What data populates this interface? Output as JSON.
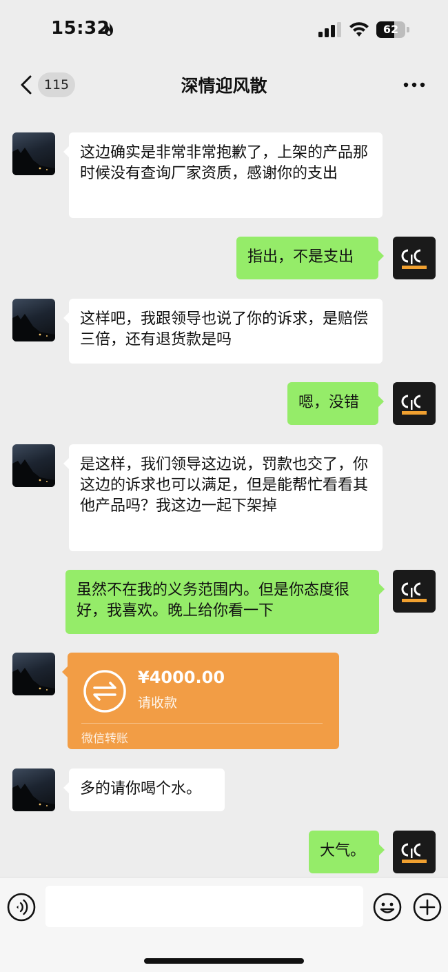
{
  "status_bar": {
    "time": "15:32",
    "battery": "62",
    "battery_level": 0.62,
    "icons": [
      "flame-icon",
      "signal-icon",
      "wifi-icon",
      "battery-icon"
    ]
  },
  "nav": {
    "unread_count": "115",
    "title": "深情迎风散",
    "icons": [
      "chevron-left-icon",
      "more-icon"
    ]
  },
  "messages": [
    {
      "side": "left",
      "text": "这边确实是非常非常抱歉了，上架的产品那时候没有查询厂家资质，感谢你的支出"
    },
    {
      "side": "right",
      "text": "指出，不是支出"
    },
    {
      "side": "left",
      "text": "这样吧，我跟领导也说了你的诉求，是赔偿三倍，还有退货款是吗"
    },
    {
      "side": "right",
      "text": "嗯，没错"
    },
    {
      "side": "left",
      "text": "是这样，我们领导这边说，罚款也交了，你这边的诉求也可以满足，但是能帮忙看看其他产品吗？我这边一起下架掉"
    },
    {
      "side": "right",
      "text": "虽然不在我的义务范围内。但是你态度很好，我喜欢。晚上给你看一下"
    },
    {
      "side": "left",
      "type": "transfer",
      "amount": "¥4000.00",
      "status": "请收款",
      "label": "微信转账"
    },
    {
      "side": "left",
      "text": "多的请你喝个水。"
    },
    {
      "side": "right",
      "text": "大气。"
    }
  ],
  "input_bar": {
    "placeholder": "",
    "icons": [
      "voice-icon",
      "emoji-icon",
      "plus-icon"
    ]
  },
  "colors": {
    "background": "#ededed",
    "self_bubble": "#95ec69",
    "other_bubble": "#ffffff",
    "transfer_card": "#f29d45"
  }
}
